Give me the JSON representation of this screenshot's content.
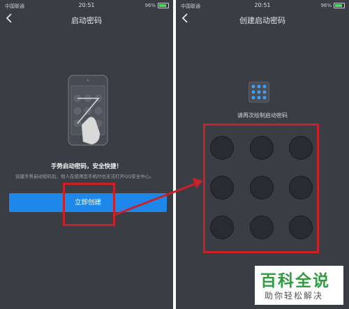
{
  "status_bar": {
    "carrier": "中国联通",
    "time": "20:51",
    "battery": "96%"
  },
  "left_screen": {
    "nav_title": "启动密码",
    "back_icon": "chevron-left-icon",
    "guide_title": "手势启动密码，安全快捷！",
    "guide_desc": "创建手势启动密码后，他人在使用您手机时也无法打开QQ安全中心。",
    "create_button_label": "立即创建"
  },
  "right_screen": {
    "nav_title": "创建启动密码",
    "back_icon": "chevron-left-icon",
    "hint": "请再次绘制启动密码",
    "pattern_icon": "nine-dot-grid-icon",
    "pattern_dots": 9
  },
  "watermark": {
    "title": "百科全说",
    "subtitle": "助你轻松解决"
  },
  "colors": {
    "background": "#3b3d44",
    "accent": "#1e88ea",
    "highlight": "#c92127",
    "watermark": "#2f9e3f"
  }
}
